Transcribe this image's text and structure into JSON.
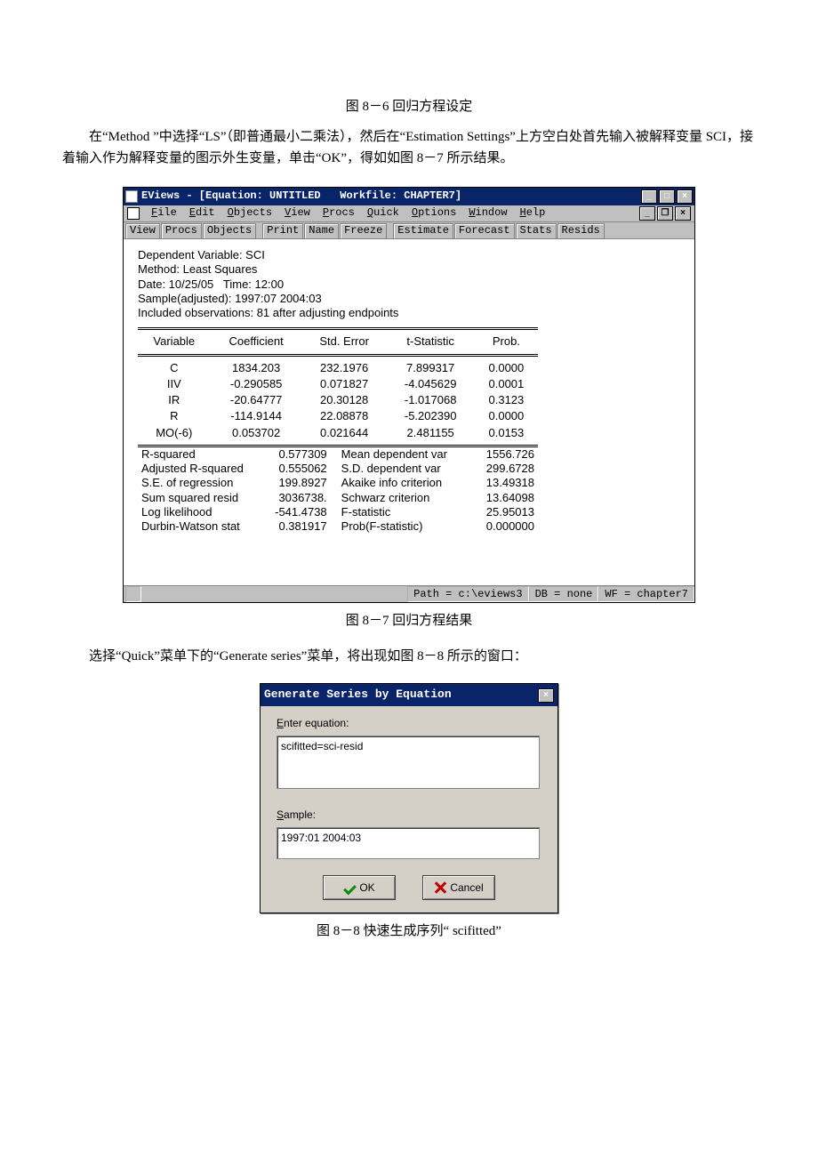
{
  "caption1": "图 8－6  回归方程设定",
  "para1": "在“Method ”中选择“LS”（即普通最小二乘法），然后在“Estimation  Settings”上方空白处首先输入被解释变量 SCI，接着输入作为解释变量的图示外生变量，单击“OK”，得如如图 8－7 所示结果。",
  "eviews": {
    "title": "EViews - [Equation: UNTITLED   Workfile: CHAPTER7]",
    "menubar": [
      "File",
      "Edit",
      "Objects",
      "View",
      "Procs",
      "Quick",
      "Options",
      "Window",
      "Help"
    ],
    "toolbar_groups": [
      [
        "View",
        "Procs",
        "Objects"
      ],
      [
        "Print",
        "Name",
        "Freeze"
      ],
      [
        "Estimate",
        "Forecast",
        "Stats",
        "Resids"
      ]
    ],
    "info_lines": [
      "Dependent Variable: SCI",
      "Method: Least Squares",
      "Date: 10/25/05   Time: 12:00",
      "Sample(adjusted): 1997:07 2004:03",
      "Included observations: 81 after adjusting endpoints"
    ],
    "coef_headers": [
      "Variable",
      "Coefficient",
      "Std. Error",
      "t-Statistic",
      "Prob."
    ],
    "coef_rows": [
      {
        "var": "C",
        "coef": "1834.203",
        "se": "232.1976",
        "t": "7.899317",
        "p": "0.0000"
      },
      {
        "var": "IIV",
        "coef": "-0.290585",
        "se": "0.071827",
        "t": "-4.045629",
        "p": "0.0001"
      },
      {
        "var": "IR",
        "coef": "-20.64777",
        "se": "20.30128",
        "t": "-1.017068",
        "p": "0.3123"
      },
      {
        "var": "R",
        "coef": "-114.9144",
        "se": "22.08878",
        "t": "-5.202390",
        "p": "0.0000"
      },
      {
        "var": "MO(-6)",
        "coef": "0.053702",
        "se": "0.021644",
        "t": "2.481155",
        "p": "0.0153"
      }
    ],
    "summary_rows": [
      {
        "l": "R-squared",
        "v": "0.577309",
        "l2": "Mean dependent var",
        "v2": "1556.726"
      },
      {
        "l": "Adjusted R-squared",
        "v": "0.555062",
        "l2": "S.D. dependent var",
        "v2": "299.6728"
      },
      {
        "l": "S.E. of regression",
        "v": "199.8927",
        "l2": "Akaike info criterion",
        "v2": "13.49318"
      },
      {
        "l": "Sum squared resid",
        "v": "3036738.",
        "l2": "Schwarz criterion",
        "v2": "13.64098"
      },
      {
        "l": "Log likelihood",
        "v": "-541.4738",
        "l2": "F-statistic",
        "v2": "25.95013"
      },
      {
        "l": "Durbin-Watson stat",
        "v": "0.381917",
        "l2": "Prob(F-statistic)",
        "v2": "0.000000"
      }
    ],
    "status": {
      "path": "Path = c:\\eviews3",
      "db": "DB = none",
      "wf": "WF = chapter7"
    }
  },
  "caption2": "图 8－7  回归方程结果",
  "para2": "选择“Quick”菜单下的“Generate series”菜单，将出现如图 8－8 所示的窗口：",
  "dialog": {
    "title": "Generate Series by Equation",
    "enter_label": "Enter equation:",
    "equation": "scifitted=sci-resid",
    "sample_label": "Sample:",
    "sample": "1997:01 2004:03",
    "ok": "OK",
    "cancel": "Cancel"
  },
  "caption3": "图 8－8   快速生成序列“ scifitted”"
}
